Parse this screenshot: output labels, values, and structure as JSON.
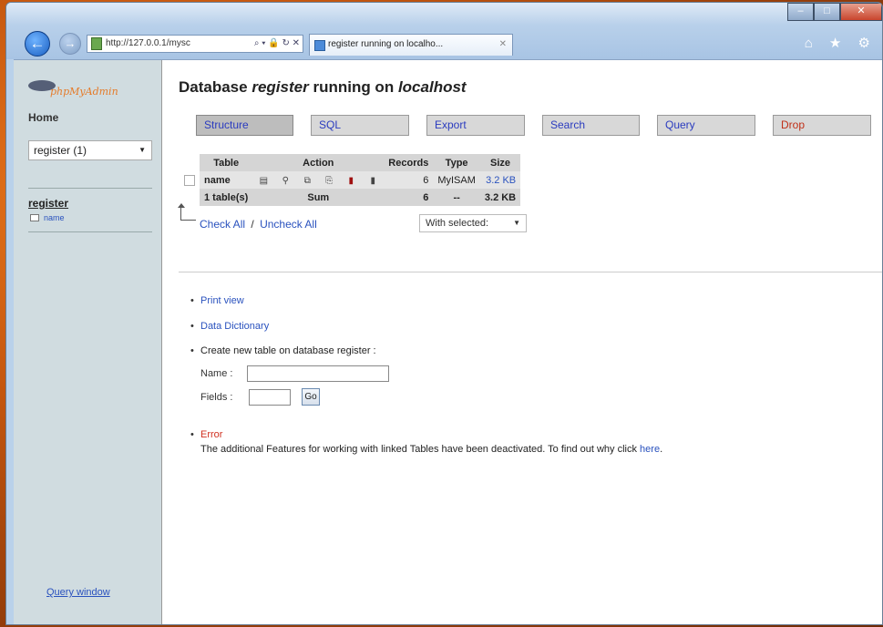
{
  "browser": {
    "address_url": "http://127.0.0.1/mysc",
    "address_icons": "⌕ ▾ 🔒 ↻ ✕",
    "tab_title": "register running on localho...",
    "tab_close": "✕",
    "back_icon": "arrow-left-icon",
    "forward_icon": "arrow-right-icon",
    "toolbar_icons": "⌂ ★ ⚙",
    "window_controls": {
      "minimize": "–",
      "maximize": "□",
      "close": "✕"
    }
  },
  "sidebar": {
    "logo_text": "phpMyAdmin",
    "home_label": "Home",
    "db_select_value": "register (1)",
    "db_name": "register",
    "table_name": "name",
    "query_window_label": "Query window"
  },
  "main": {
    "title_prefix": "Database",
    "title_db": "register",
    "title_mid": "running on",
    "title_host": "localhost",
    "tabs": [
      {
        "label": "Structure"
      },
      {
        "label": "SQL"
      },
      {
        "label": "Export"
      },
      {
        "label": "Search"
      },
      {
        "label": "Query"
      },
      {
        "label": "Drop"
      }
    ],
    "table": {
      "headers": {
        "table": "Table",
        "action": "Action",
        "records": "Records",
        "type": "Type",
        "size": "Size"
      },
      "rows": [
        {
          "name": "name",
          "records": "6",
          "type": "MyISAM",
          "size": "3.2 KB"
        }
      ],
      "sum_row": {
        "label": "1 table(s)",
        "sum_label": "Sum",
        "records": "6",
        "type": "--",
        "size": "3.2 KB"
      }
    },
    "check_all": "Check All",
    "separator": "/",
    "uncheck_all": "Uncheck All",
    "with_selected": "With selected:",
    "links": {
      "print_view": "Print view",
      "data_dictionary": "Data Dictionary",
      "create_table": "Create new table on database register :",
      "name_label": "Name :",
      "fields_label": "Fields :",
      "go_label": "Go",
      "error_label": "Error",
      "feature_text": "The additional Features for working with linked Tables have been deactivated. To find out why click",
      "here_link": "here"
    }
  },
  "colors": {
    "sidebar_bg": "#d0dce0",
    "link": "#2a52be",
    "drop_red": "#c03018",
    "error_red": "#d03020"
  }
}
